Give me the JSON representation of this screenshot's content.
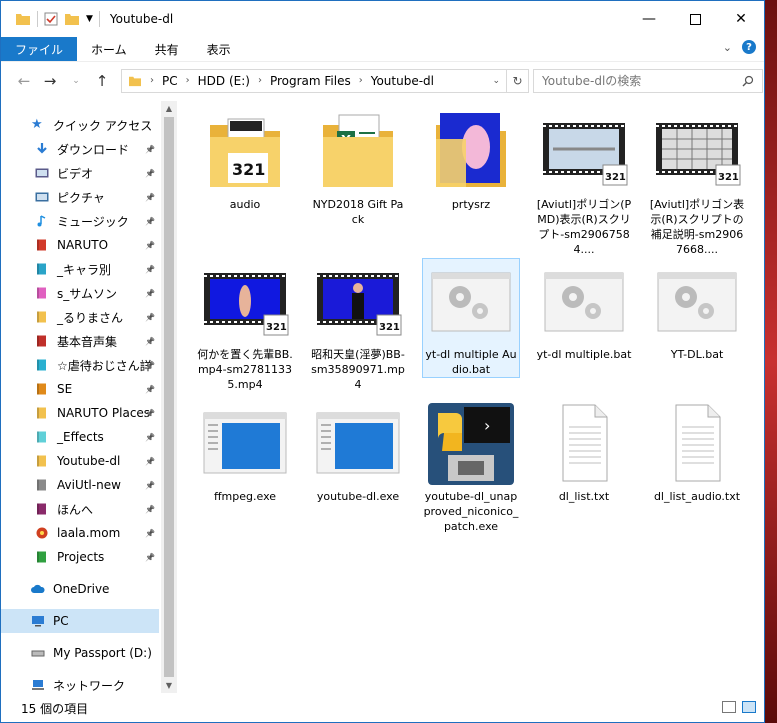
{
  "window": {
    "title": "Youtube-dl"
  },
  "ribbon": {
    "tabs": [
      "ファイル",
      "ホーム",
      "共有",
      "表示"
    ]
  },
  "address": {
    "crumbs": [
      "PC",
      "HDD (E:)",
      "Program Files",
      "Youtube-dl"
    ],
    "search_placeholder": "Youtube-dlの検索"
  },
  "sidebar": {
    "quick_access": "クイック アクセス",
    "items": [
      {
        "label": "ダウンロード",
        "icon": "download-icon",
        "color": "#2b7cd3"
      },
      {
        "label": "ビデオ",
        "icon": "video-icon",
        "color": "#5a5a8a"
      },
      {
        "label": "ピクチャ",
        "icon": "pictures-icon",
        "color": "#3a6fa0"
      },
      {
        "label": "ミュージック",
        "icon": "music-icon",
        "color": "#1f8fe0"
      },
      {
        "label": "NARUTO",
        "icon": "folder-icon",
        "color": "#d23a2a"
      },
      {
        "label": "_キャラ別",
        "icon": "folder-icon",
        "color": "#2aa4c8"
      },
      {
        "label": "s_サムソン",
        "icon": "folder-icon",
        "color": "#e060c0"
      },
      {
        "label": "_るりまさん",
        "icon": "folder-icon",
        "color": "#f2c14e"
      },
      {
        "label": "基本音声集",
        "icon": "folder-icon",
        "color": "#c0302a"
      },
      {
        "label": "☆虐待おじさん詳",
        "icon": "folder-icon",
        "color": "#2ab0d0"
      },
      {
        "label": "SE",
        "icon": "folder-icon",
        "color": "#e08a1a"
      },
      {
        "label": "NARUTO Places",
        "icon": "folder-icon",
        "color": "#f2c14e"
      },
      {
        "label": "_Effects",
        "icon": "folder-icon",
        "color": "#60d0d8"
      },
      {
        "label": "Youtube-dl",
        "icon": "folder-icon",
        "color": "#f2c14e"
      },
      {
        "label": "AviUtl-new",
        "icon": "folder-icon",
        "color": "#8a8a8a"
      },
      {
        "label": "ほんへ",
        "icon": "folder-icon",
        "color": "#8a2a6a"
      },
      {
        "label": "laala.mom",
        "icon": "app-icon",
        "color": "#d04020"
      },
      {
        "label": "Projects",
        "icon": "folder-icon",
        "color": "#30a040"
      }
    ],
    "onedrive": "OneDrive",
    "pc": "PC",
    "passport": "My Passport (D:)",
    "network": "ネットワーク"
  },
  "files": [
    {
      "name": "audio",
      "type": "folder-media"
    },
    {
      "name": "NYD2018 Gift Pack",
      "type": "folder-excel"
    },
    {
      "name": "prtysrz",
      "type": "folder-image"
    },
    {
      "name": "[Aviutl]ポリゴン(PMD)表示(R)スクリプト-sm29067584....",
      "type": "video-light"
    },
    {
      "name": "[Aviutl]ポリゴン表示(R)スクリプトの補足説明-sm29067668....",
      "type": "video-grid"
    },
    {
      "name": "何かを置く先輩BB.mp4-sm27811335.mp4",
      "type": "video-blue"
    },
    {
      "name": "昭和天皇(淫夢)BB-sm35890971.mp4",
      "type": "video-blue-dark"
    },
    {
      "name": "yt-dl multiple Audio.bat",
      "type": "bat"
    },
    {
      "name": "yt-dl multiple.bat",
      "type": "bat"
    },
    {
      "name": "YT-DL.bat",
      "type": "bat"
    },
    {
      "name": "ffmpeg.exe",
      "type": "exe"
    },
    {
      "name": "youtube-dl.exe",
      "type": "exe"
    },
    {
      "name": "youtube-dl_unapproved_niconico_patch.exe",
      "type": "python"
    },
    {
      "name": "dl_list.txt",
      "type": "txt"
    },
    {
      "name": "dl_list_audio.txt",
      "type": "txt"
    }
  ],
  "status": {
    "count": "15 個の項目"
  },
  "colors": {
    "accent": "#1979ca",
    "folder": "#f2c14e",
    "selection": "#e5f3ff"
  }
}
